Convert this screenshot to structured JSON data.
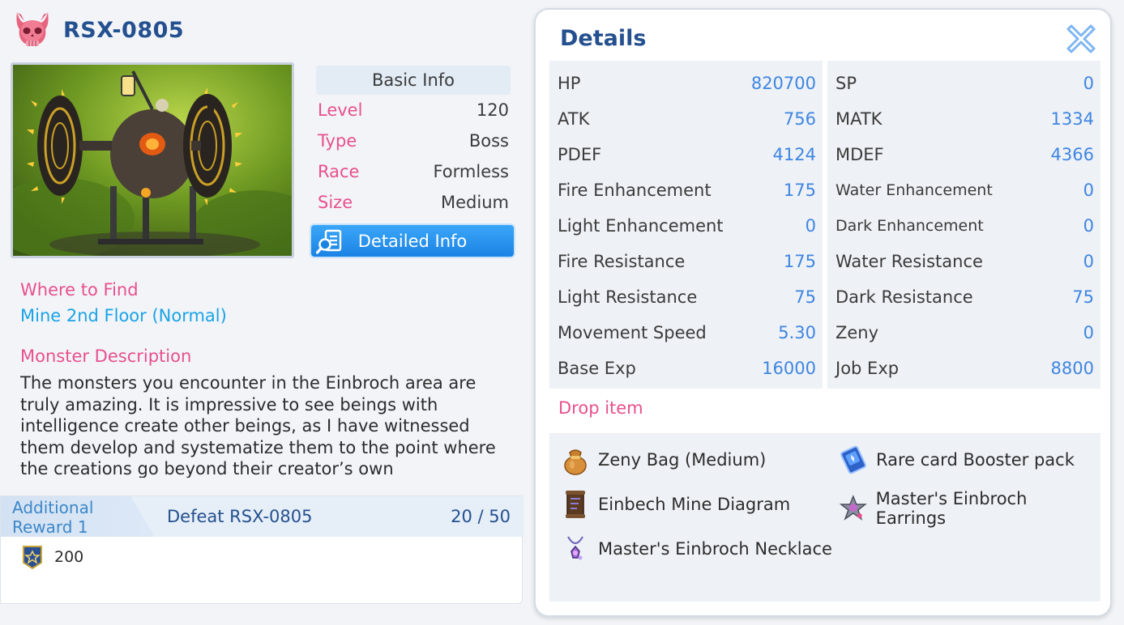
{
  "monster": {
    "name": "RSX-0805"
  },
  "basic_info": {
    "header": "Basic Info",
    "rows": [
      {
        "label": "Level",
        "value": "120"
      },
      {
        "label": "Type",
        "value": "Boss"
      },
      {
        "label": "Race",
        "value": "Formless"
      },
      {
        "label": "Size",
        "value": "Medium"
      }
    ],
    "detail_button": "Detailed Info"
  },
  "where_to_find": {
    "label": "Where to Find",
    "value": "Mine 2nd Floor (Normal)"
  },
  "description": {
    "label": "Monster Description",
    "text": "The monsters you encounter in the Einbroch area are truly amazing. It is impressive to see beings with intelligence create other beings, as I have witnessed them develop and systematize them to the point where the creations go beyond their creator’s own"
  },
  "reward": {
    "tab_label": "Additional Reward 1",
    "goal": "Defeat RSX-0805",
    "progress": "20 / 50",
    "item_amount": "200"
  },
  "details": {
    "title": "Details",
    "left_stats": [
      {
        "label": "HP",
        "value": "820700"
      },
      {
        "label": "ATK",
        "value": "756"
      },
      {
        "label": "PDEF",
        "value": "4124"
      },
      {
        "label": "Fire Enhancement",
        "value": "175"
      },
      {
        "label": "Light Enhancement",
        "value": "0"
      },
      {
        "label": "Fire Resistance",
        "value": "175"
      },
      {
        "label": "Light Resistance",
        "value": "75"
      },
      {
        "label": "Movement Speed",
        "value": "5.30"
      },
      {
        "label": "Base Exp",
        "value": "16000"
      }
    ],
    "right_stats": [
      {
        "label": "SP",
        "value": "0"
      },
      {
        "label": "MATK",
        "value": "1334"
      },
      {
        "label": "MDEF",
        "value": "4366"
      },
      {
        "label": "Water Enhancement",
        "value": "0"
      },
      {
        "label": "Dark Enhancement",
        "value": "0"
      },
      {
        "label": "Water Resistance",
        "value": "0"
      },
      {
        "label": "Dark Resistance",
        "value": "75"
      },
      {
        "label": "Zeny",
        "value": "0"
      },
      {
        "label": "Job Exp",
        "value": "8800"
      }
    ]
  },
  "drops": {
    "title": "Drop item",
    "items": [
      {
        "name": "Zeny Bag (Medium)",
        "icon": "zeny-bag-icon"
      },
      {
        "name": "Rare card Booster pack",
        "icon": "card-pack-icon"
      },
      {
        "name": "Einbech Mine Diagram",
        "icon": "scroll-icon"
      },
      {
        "name": "Master's Einbroch Earrings",
        "icon": "earrings-icon"
      },
      {
        "name": "Master's Einbroch Necklace",
        "icon": "necklace-icon"
      }
    ]
  },
  "colors": {
    "title_blue": "#24508f",
    "label_pink": "#e8508e",
    "value_blue": "#3f86e2",
    "link_cyan": "#1aa3e6",
    "button_blue": "#1b83e4"
  }
}
